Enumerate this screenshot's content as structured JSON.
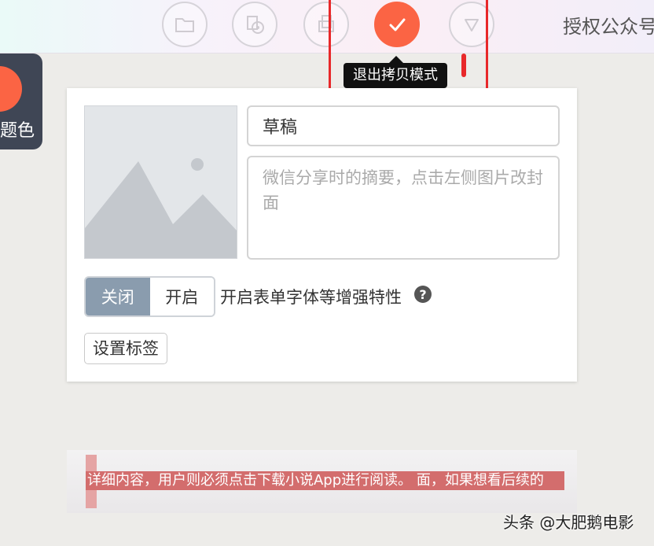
{
  "toolbar": {
    "tools": [
      {
        "icon": "folder-icon"
      },
      {
        "icon": "disc-icon"
      },
      {
        "icon": "copy-icon"
      },
      {
        "icon": "check-icon",
        "active": true
      },
      {
        "icon": "triangle-down-icon"
      }
    ],
    "brand_text": "授权公众号",
    "tooltip": "退出拷贝模式"
  },
  "side_panel": {
    "label": "题色"
  },
  "editor": {
    "title_value": "草稿",
    "summary_placeholder": "微信分享时的摘要，点击左侧图片改封面",
    "toggle": {
      "on_label": "关闭",
      "off_label": "开启"
    },
    "enhance_label": "开启表单字体等增强特性",
    "help_icon": "?",
    "tag_button": "设置标签"
  },
  "banner": {
    "text": "详细内容，用户则必须点击下载小说App进行阅读。 面，如果想看后续的"
  },
  "watermark": "头条 @大肥鹅电影",
  "colors": {
    "accent": "#fb6444",
    "highlight_box": "#e8282a",
    "toggle_on": "#8a9cae",
    "side_panel": "#3f4655"
  }
}
